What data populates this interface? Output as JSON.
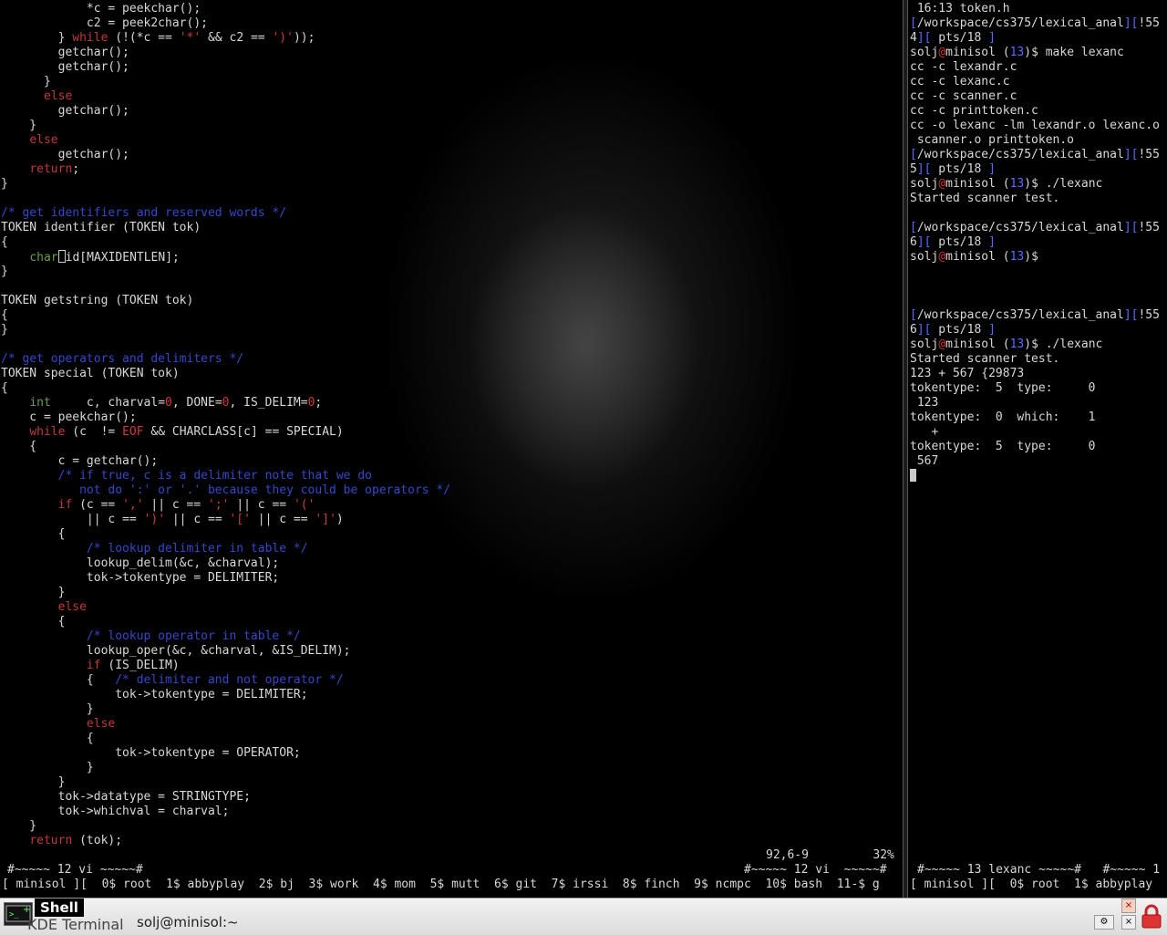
{
  "left_pane": {
    "code_lines": [
      [
        {
          "t": "            *c = peekchar();",
          "c": "def"
        }
      ],
      [
        {
          "t": "            c2 = peek2char();",
          "c": "def"
        }
      ],
      [
        {
          "t": "        } ",
          "c": "def"
        },
        {
          "t": "while",
          "c": "kw"
        },
        {
          "t": " (!(*c == ",
          "c": "def"
        },
        {
          "t": "'*'",
          "c": "st"
        },
        {
          "t": " && c2 == ",
          "c": "def"
        },
        {
          "t": "')'",
          "c": "st"
        },
        {
          "t": "));",
          "c": "def"
        }
      ],
      [
        {
          "t": "        getchar();",
          "c": "def"
        }
      ],
      [
        {
          "t": "        getchar();",
          "c": "def"
        }
      ],
      [
        {
          "t": "      }",
          "c": "def"
        }
      ],
      [
        {
          "t": "      ",
          "c": "def"
        },
        {
          "t": "else",
          "c": "kw"
        }
      ],
      [
        {
          "t": "        getchar();",
          "c": "def"
        }
      ],
      [
        {
          "t": "    }",
          "c": "def"
        }
      ],
      [
        {
          "t": "    ",
          "c": "def"
        },
        {
          "t": "else",
          "c": "kw"
        }
      ],
      [
        {
          "t": "        getchar();",
          "c": "def"
        }
      ],
      [
        {
          "t": "    ",
          "c": "def"
        },
        {
          "t": "return",
          "c": "kw"
        },
        {
          "t": ";",
          "c": "def"
        }
      ],
      [
        {
          "t": "}",
          "c": "def"
        }
      ],
      [
        {
          "t": "",
          "c": "def"
        }
      ],
      [
        {
          "t": "/* get identifiers and reserved words */",
          "c": "cm"
        }
      ],
      [
        {
          "t": "TOKEN identifier (TOKEN tok)",
          "c": "def"
        }
      ],
      [
        {
          "t": "{",
          "c": "def"
        }
      ],
      [
        {
          "t": "    ",
          "c": "def"
        },
        {
          "t": "char",
          "c": "ty"
        },
        {
          "t": "CURSOR",
          "c": "cur"
        },
        {
          "t": "id[MAXIDENTLEN];",
          "c": "def"
        }
      ],
      [
        {
          "t": "}",
          "c": "def"
        }
      ],
      [
        {
          "t": "",
          "c": "def"
        }
      ],
      [
        {
          "t": "TOKEN getstring (TOKEN tok)",
          "c": "def"
        }
      ],
      [
        {
          "t": "{",
          "c": "def"
        }
      ],
      [
        {
          "t": "}",
          "c": "def"
        }
      ],
      [
        {
          "t": "",
          "c": "def"
        }
      ],
      [
        {
          "t": "/* get operators and delimiters */",
          "c": "cm"
        }
      ],
      [
        {
          "t": "TOKEN special (TOKEN tok)",
          "c": "def"
        }
      ],
      [
        {
          "t": "{",
          "c": "def"
        }
      ],
      [
        {
          "t": "    ",
          "c": "def"
        },
        {
          "t": "int",
          "c": "ty"
        },
        {
          "t": "     c, charval=",
          "c": "def"
        },
        {
          "t": "0",
          "c": "st"
        },
        {
          "t": ", DONE=",
          "c": "def"
        },
        {
          "t": "0",
          "c": "st"
        },
        {
          "t": ", IS_DELIM=",
          "c": "def"
        },
        {
          "t": "0",
          "c": "st"
        },
        {
          "t": ";",
          "c": "def"
        }
      ],
      [
        {
          "t": "    c = peekchar();",
          "c": "def"
        }
      ],
      [
        {
          "t": "    ",
          "c": "def"
        },
        {
          "t": "while",
          "c": "kw"
        },
        {
          "t": " (c  != ",
          "c": "def"
        },
        {
          "t": "EOF",
          "c": "st"
        },
        {
          "t": " && CHARCLASS[c] == SPECIAL)",
          "c": "def"
        }
      ],
      [
        {
          "t": "    {",
          "c": "def"
        }
      ],
      [
        {
          "t": "        c = getchar();",
          "c": "def"
        }
      ],
      [
        {
          "t": "        /* if true, c is a delimiter note that we do",
          "c": "cm"
        }
      ],
      [
        {
          "t": "           not do ':' or '.' because they could be operators */",
          "c": "cm"
        }
      ],
      [
        {
          "t": "        ",
          "c": "def"
        },
        {
          "t": "if",
          "c": "kw"
        },
        {
          "t": " (c == ",
          "c": "def"
        },
        {
          "t": "','",
          "c": "st"
        },
        {
          "t": " || c == ",
          "c": "def"
        },
        {
          "t": "';'",
          "c": "st"
        },
        {
          "t": " || c == ",
          "c": "def"
        },
        {
          "t": "'('",
          "c": "st"
        }
      ],
      [
        {
          "t": "            || c == ",
          "c": "def"
        },
        {
          "t": "')'",
          "c": "st"
        },
        {
          "t": " || c == ",
          "c": "def"
        },
        {
          "t": "'['",
          "c": "st"
        },
        {
          "t": " || c == ",
          "c": "def"
        },
        {
          "t": "']'",
          "c": "st"
        },
        {
          "t": ")",
          "c": "def"
        }
      ],
      [
        {
          "t": "        {",
          "c": "def"
        }
      ],
      [
        {
          "t": "            /* lookup delimiter in table */",
          "c": "cm"
        }
      ],
      [
        {
          "t": "            lookup_delim(&c, &charval);",
          "c": "def"
        }
      ],
      [
        {
          "t": "            tok->tokentype = DELIMITER;",
          "c": "def"
        }
      ],
      [
        {
          "t": "        }",
          "c": "def"
        }
      ],
      [
        {
          "t": "        ",
          "c": "def"
        },
        {
          "t": "else",
          "c": "kw"
        }
      ],
      [
        {
          "t": "        {",
          "c": "def"
        }
      ],
      [
        {
          "t": "            /* lookup operator in table */",
          "c": "cm"
        }
      ],
      [
        {
          "t": "            lookup_oper(&c, &charval, &IS_DELIM);",
          "c": "def"
        }
      ],
      [
        {
          "t": "            ",
          "c": "def"
        },
        {
          "t": "if",
          "c": "kw"
        },
        {
          "t": " (IS_DELIM)",
          "c": "def"
        }
      ],
      [
        {
          "t": "            {   ",
          "c": "def"
        },
        {
          "t": "/* delimiter and not operator */",
          "c": "cm"
        }
      ],
      [
        {
          "t": "                tok->tokentype = DELIMITER;",
          "c": "def"
        }
      ],
      [
        {
          "t": "            }",
          "c": "def"
        }
      ],
      [
        {
          "t": "            ",
          "c": "def"
        },
        {
          "t": "else",
          "c": "kw"
        }
      ],
      [
        {
          "t": "            {",
          "c": "def"
        }
      ],
      [
        {
          "t": "                tok->tokentype = OPERATOR;",
          "c": "def"
        }
      ],
      [
        {
          "t": "            }",
          "c": "def"
        }
      ],
      [
        {
          "t": "        }",
          "c": "def"
        }
      ],
      [
        {
          "t": "        tok->datatype = STRINGTYPE;",
          "c": "def"
        }
      ],
      [
        {
          "t": "        tok->whichval = charval;",
          "c": "def"
        }
      ],
      [
        {
          "t": "    }",
          "c": "def"
        }
      ],
      [
        {
          "t": "    ",
          "c": "def"
        },
        {
          "t": "return",
          "c": "kw"
        },
        {
          "t": " (tok);",
          "c": "def"
        }
      ]
    ],
    "ruler": "92,6-9         32%",
    "screen_status_left": "#~~~~~ 12 vi ~~~~~#",
    "screen_status_right": "#~~~~~ 12 vi  ~~~~~#",
    "window_list": "[ minisol ][  0$ root  1$ abbyplay  2$ bj  3$ work  4$ mom  5$ mutt  6$ git  7$ irssi  8$ finch  9$ ncmpc  10$ bash  11-$ g"
  },
  "right_pane": {
    "lines": [
      [
        {
          "t": " 16:13 token.h",
          "c": "def"
        }
      ],
      [
        {
          "t": "[",
          "c": "bl"
        },
        {
          "t": "/workspace/cs375/lexical_anal",
          "c": "def"
        },
        {
          "t": "][",
          "c": "bl"
        },
        {
          "t": "!55",
          "c": "def"
        }
      ],
      [
        {
          "t": "4",
          "c": "def"
        },
        {
          "t": "][",
          "c": "bl"
        },
        {
          "t": " pts/18 ",
          "c": "def"
        },
        {
          "t": "]",
          "c": "bl"
        }
      ],
      [
        {
          "t": "solj",
          "c": "def"
        },
        {
          "t": "@",
          "c": "pr"
        },
        {
          "t": "minisol (",
          "c": "def"
        },
        {
          "t": "13",
          "c": "bl"
        },
        {
          "t": ")$ make lexanc",
          "c": "def"
        }
      ],
      [
        {
          "t": "cc -c lexandr.c",
          "c": "def"
        }
      ],
      [
        {
          "t": "cc -c lexanc.c",
          "c": "def"
        }
      ],
      [
        {
          "t": "cc -c scanner.c",
          "c": "def"
        }
      ],
      [
        {
          "t": "cc -c printtoken.c",
          "c": "def"
        }
      ],
      [
        {
          "t": "cc -o lexanc -lm lexandr.o lexanc.o",
          "c": "def"
        }
      ],
      [
        {
          "t": " scanner.o printtoken.o",
          "c": "def"
        }
      ],
      [
        {
          "t": "[",
          "c": "bl"
        },
        {
          "t": "/workspace/cs375/lexical_anal",
          "c": "def"
        },
        {
          "t": "][",
          "c": "bl"
        },
        {
          "t": "!55",
          "c": "def"
        }
      ],
      [
        {
          "t": "5",
          "c": "def"
        },
        {
          "t": "][",
          "c": "bl"
        },
        {
          "t": " pts/18 ",
          "c": "def"
        },
        {
          "t": "]",
          "c": "bl"
        }
      ],
      [
        {
          "t": "solj",
          "c": "def"
        },
        {
          "t": "@",
          "c": "pr"
        },
        {
          "t": "minisol (",
          "c": "def"
        },
        {
          "t": "13",
          "c": "bl"
        },
        {
          "t": ")$ ./lexanc",
          "c": "def"
        }
      ],
      [
        {
          "t": "Started scanner test.",
          "c": "def"
        }
      ],
      [
        {
          "t": "",
          "c": "def"
        }
      ],
      [
        {
          "t": "[",
          "c": "bl"
        },
        {
          "t": "/workspace/cs375/lexical_anal",
          "c": "def"
        },
        {
          "t": "][",
          "c": "bl"
        },
        {
          "t": "!55",
          "c": "def"
        }
      ],
      [
        {
          "t": "6",
          "c": "def"
        },
        {
          "t": "][",
          "c": "bl"
        },
        {
          "t": " pts/18 ",
          "c": "def"
        },
        {
          "t": "]",
          "c": "bl"
        }
      ],
      [
        {
          "t": "solj",
          "c": "def"
        },
        {
          "t": "@",
          "c": "pr"
        },
        {
          "t": "minisol (",
          "c": "def"
        },
        {
          "t": "13",
          "c": "bl"
        },
        {
          "t": ")$",
          "c": "def"
        }
      ],
      [
        {
          "t": "",
          "c": "def"
        }
      ],
      [
        {
          "t": "",
          "c": "def"
        }
      ],
      [
        {
          "t": "",
          "c": "def"
        }
      ],
      [
        {
          "t": "[",
          "c": "bl"
        },
        {
          "t": "/workspace/cs375/lexical_anal",
          "c": "def"
        },
        {
          "t": "][",
          "c": "bl"
        },
        {
          "t": "!55",
          "c": "def"
        }
      ],
      [
        {
          "t": "6",
          "c": "def"
        },
        {
          "t": "][",
          "c": "bl"
        },
        {
          "t": " pts/18 ",
          "c": "def"
        },
        {
          "t": "]",
          "c": "bl"
        }
      ],
      [
        {
          "t": "solj",
          "c": "def"
        },
        {
          "t": "@",
          "c": "pr"
        },
        {
          "t": "minisol (",
          "c": "def"
        },
        {
          "t": "13",
          "c": "bl"
        },
        {
          "t": ")$ ./lexanc",
          "c": "def"
        }
      ],
      [
        {
          "t": "Started scanner test.",
          "c": "def"
        }
      ],
      [
        {
          "t": "123 + 567 {29873",
          "c": "def"
        }
      ],
      [
        {
          "t": "tokentype:  5  type:     0",
          "c": "def"
        }
      ],
      [
        {
          "t": " 123",
          "c": "def"
        }
      ],
      [
        {
          "t": "tokentype:  0  which:    1",
          "c": "def"
        }
      ],
      [
        {
          "t": "   +",
          "c": "def"
        }
      ],
      [
        {
          "t": "tokentype:  5  type:     0",
          "c": "def"
        }
      ],
      [
        {
          "t": " 567",
          "c": "def"
        }
      ],
      [
        {
          "t": "BLOCK",
          "c": "blk"
        }
      ]
    ],
    "screen_status": "#~~~~~ 13 lexanc ~~~~~#   #~~~~~ 1",
    "window_list": "[ minisol ][  0$ root  1$ abbyplay"
  },
  "taskbar": {
    "tab_label": "Shell",
    "app_name": "KDE Terminal",
    "window_title": "solj@minisol:~",
    "icon": "terminal-icon"
  }
}
